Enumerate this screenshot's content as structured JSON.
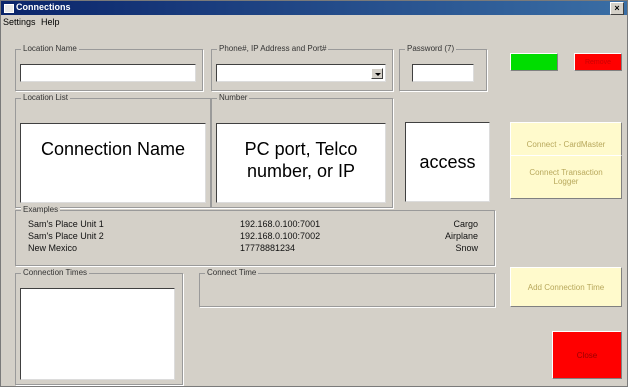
{
  "window": {
    "title": "Connections",
    "close_glyph": "×"
  },
  "menu": {
    "items": [
      "Settings",
      "Help"
    ]
  },
  "location_name": {
    "label": "Location Name",
    "value": ""
  },
  "phone": {
    "label": "Phone#, IP Address and Port#",
    "value": ""
  },
  "password": {
    "label": "Password (7)",
    "value": ""
  },
  "location_list": {
    "label": "Location List",
    "overlay": "Connection Name"
  },
  "number": {
    "label": "Number",
    "overlay": "PC port, Telco number, or IP"
  },
  "access": {
    "overlay": "access"
  },
  "examples": {
    "label": "Examples",
    "rows": [
      {
        "name": "Sam's Place Unit 1",
        "number": "192.168.0.100:7001",
        "password": "Cargo"
      },
      {
        "name": "Sam's Place Unit 2",
        "number": "192.168.0.100:7002",
        "password": "Airplane"
      },
      {
        "name": "New Mexico",
        "number": "17778881234",
        "password": "Snow"
      }
    ]
  },
  "connection_times": {
    "label": "Connection Times"
  },
  "connect_time": {
    "label": "Connect Time"
  },
  "buttons": {
    "green": {
      "label": "",
      "color": "#00dd00"
    },
    "red": {
      "label": "Remove",
      "color": "#ff0000",
      "text_color": "#cc0000"
    },
    "connect_cardmaster": "Connect - CardMaster",
    "connect_logger": "Connect Transaction Logger",
    "add_connection_time": "Add Connection Time",
    "close": {
      "label": "Close",
      "color": "#ff0000"
    }
  }
}
